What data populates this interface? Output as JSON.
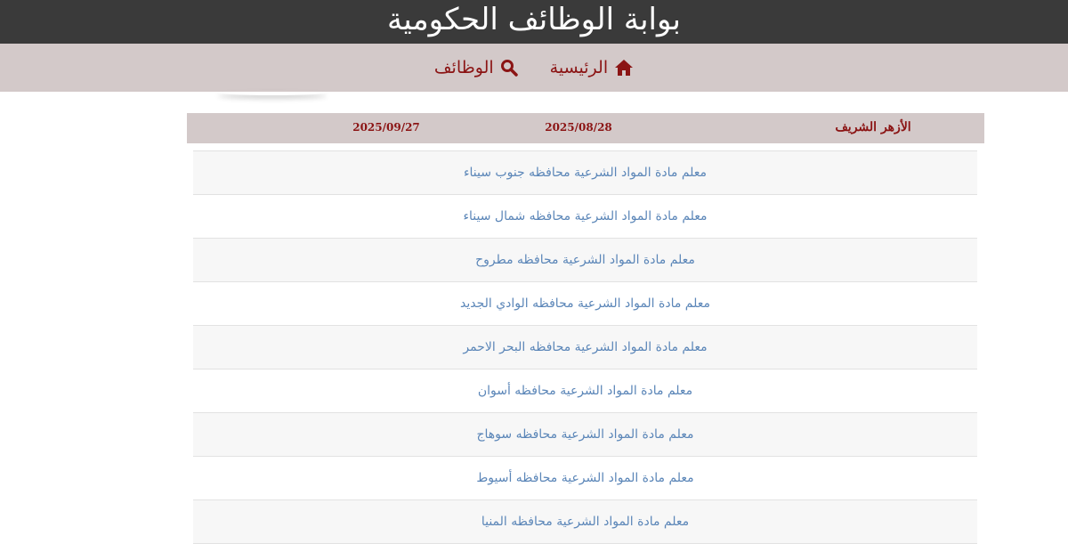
{
  "header": {
    "title": "بوابة الوظائف الحكومية"
  },
  "nav": {
    "items": [
      {
        "label": "الرئيسية",
        "icon": "home-icon"
      },
      {
        "label": "الوظائف",
        "icon": "search-icon"
      }
    ]
  },
  "info": {
    "organization": "الأزهر الشريف",
    "start_date": "2025/08/28",
    "end_date": "2025/09/27"
  },
  "jobs": [
    "معلم مادة المواد الشرعية محافظه جنوب سيناء",
    "معلم مادة المواد الشرعية محافظه شمال سيناء",
    "معلم مادة المواد الشرعية محافظه مطروح",
    "معلم مادة المواد الشرعية محافظه الوادي الجديد",
    "معلم مادة المواد الشرعية محافظه البحر الاحمر",
    "معلم مادة المواد الشرعية محافظه أسوان",
    "معلم مادة المواد الشرعية محافظه سوهاج",
    "معلم مادة المواد الشرعية محافظه أسيوط",
    "معلم مادة المواد الشرعية محافظه المنيا"
  ],
  "colors": {
    "header_bg": "#3a3a3a",
    "nav_bg": "#d3c9c9",
    "accent": "#8b1414",
    "link": "#5b86b8"
  }
}
